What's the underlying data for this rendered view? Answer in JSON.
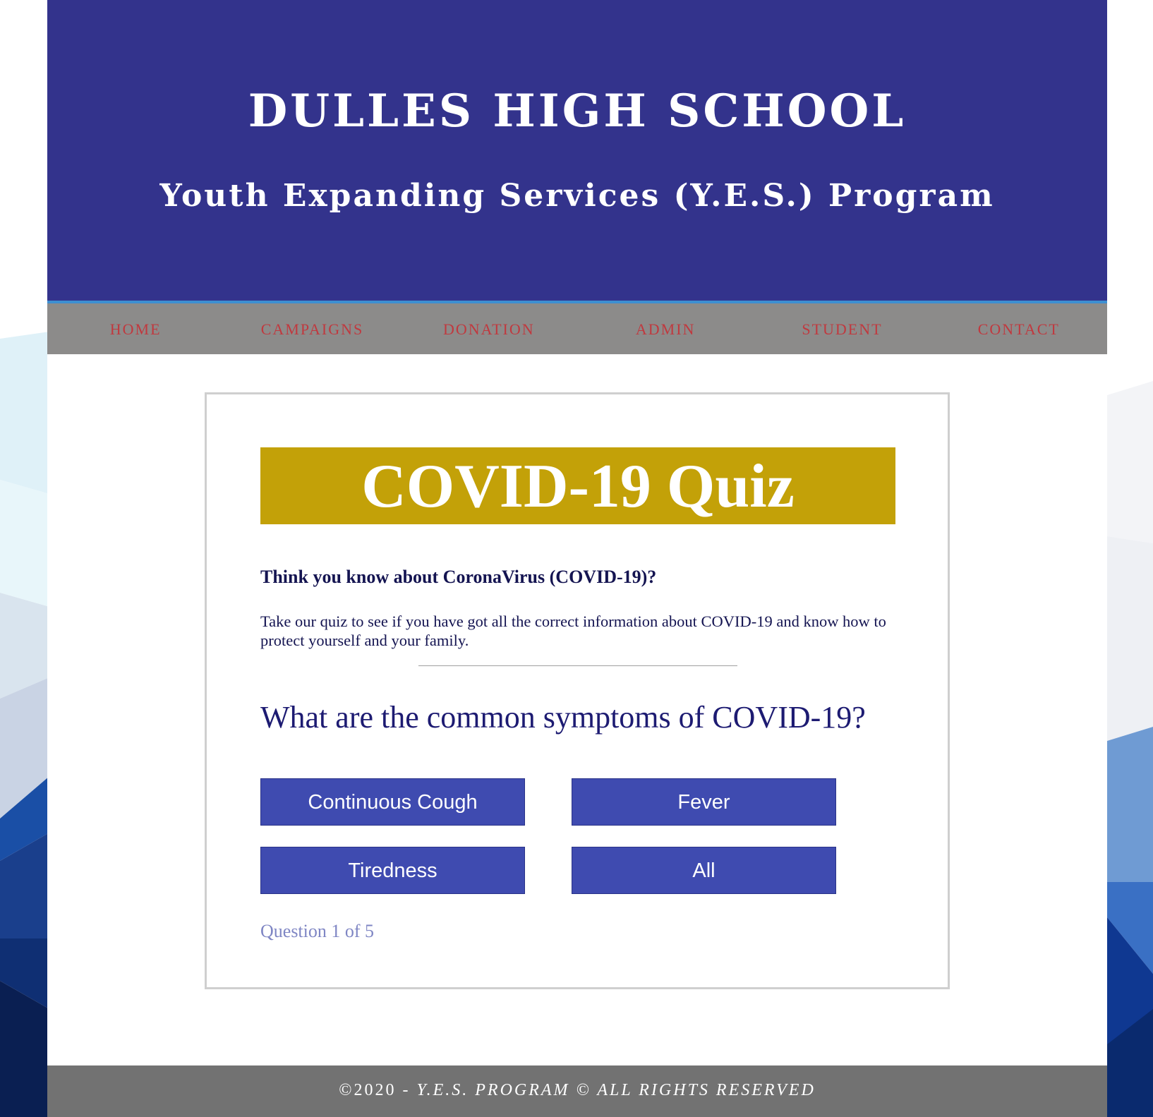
{
  "header": {
    "title": "DULLES HIGH SCHOOL",
    "subtitle": "Youth Expanding Services (Y.E.S.) Program",
    "background_color": "#33338c",
    "border_color": "#3d8fd1"
  },
  "nav": {
    "background_color": "#8c8b8a",
    "text_color": "#c0393f",
    "items": [
      {
        "label": "HOME"
      },
      {
        "label": "CAMPAIGNS"
      },
      {
        "label": "DONATION"
      },
      {
        "label": "ADMIN"
      },
      {
        "label": "STUDENT"
      },
      {
        "label": "CONTACT"
      }
    ]
  },
  "quiz": {
    "title": "COVID-19 Quiz",
    "banner_color": "#c3a108",
    "intro_heading": "Think you know about CoronaVirus (COVID-19)?",
    "intro_text": "Take our quiz to see if you have got all the correct information about COVID-19 and know how to protect yourself and your family.",
    "question": "What are the common symptoms of COVID-19?",
    "answers": [
      {
        "label": "Continuous Cough"
      },
      {
        "label": "Fever"
      },
      {
        "label": "Tiredness"
      },
      {
        "label": "All"
      }
    ],
    "button_color": "#3f4bb0",
    "progress": "Question 1 of 5"
  },
  "footer": {
    "year_text": "©2020 - ",
    "rights_text": "Y.E.S. PROGRAM © ALL RIGHTS RESERVED",
    "background_color": "#727272"
  }
}
